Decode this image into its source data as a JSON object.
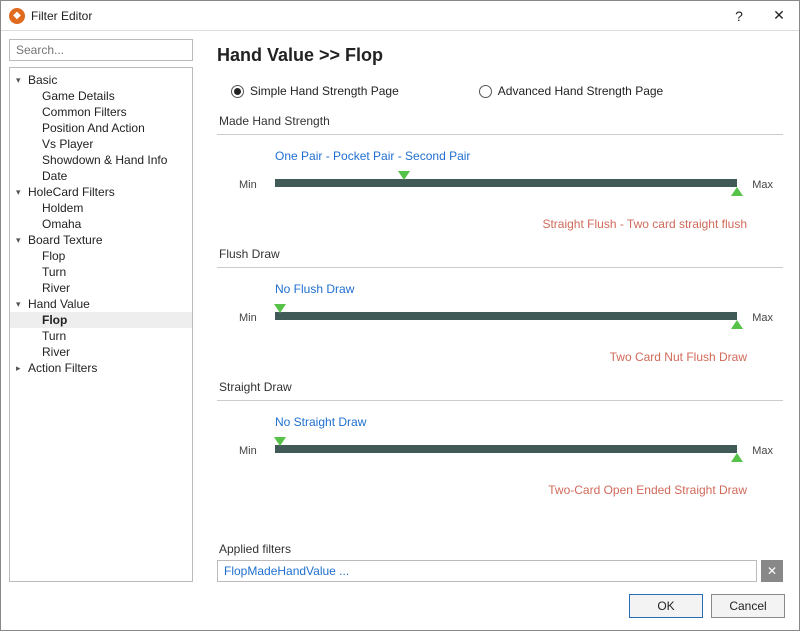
{
  "window": {
    "title": "Filter Editor"
  },
  "search": {
    "placeholder": "Search..."
  },
  "tree": {
    "basic": {
      "label": "Basic",
      "game_details": "Game Details",
      "common_filters": "Common Filters",
      "position_action": "Position And Action",
      "vs_player": "Vs Player",
      "showdown": "Showdown & Hand Info",
      "date": "Date"
    },
    "holecard": {
      "label": "HoleCard Filters",
      "holdem": "Holdem",
      "omaha": "Omaha"
    },
    "board": {
      "label": "Board Texture",
      "flop": "Flop",
      "turn": "Turn",
      "river": "River"
    },
    "handvalue": {
      "label": "Hand Value",
      "flop": "Flop",
      "turn": "Turn",
      "river": "River"
    },
    "action_filters": {
      "label": "Action Filters"
    }
  },
  "main": {
    "heading": "Hand Value >> Flop",
    "radio_simple": "Simple Hand Strength Page",
    "radio_advanced": "Advanced Hand Strength Page",
    "min": "Min",
    "max": "Max",
    "groups": {
      "made": {
        "title": "Made Hand Strength",
        "low": "One Pair - Pocket Pair - Second Pair",
        "high": "Straight Flush - Two card straight flush",
        "lo_pct": 28,
        "hi_pct": 100
      },
      "flush": {
        "title": "Flush Draw",
        "low": "No Flush Draw",
        "high": "Two Card Nut Flush Draw",
        "lo_pct": 1,
        "hi_pct": 100
      },
      "straight": {
        "title": "Straight Draw",
        "low": "No Straight Draw",
        "high": "Two-Card Open Ended Straight Draw",
        "lo_pct": 1,
        "hi_pct": 100
      }
    }
  },
  "applied": {
    "label": "Applied filters",
    "value": "FlopMadeHandValue ..."
  },
  "footer": {
    "ok": "OK",
    "cancel": "Cancel"
  }
}
